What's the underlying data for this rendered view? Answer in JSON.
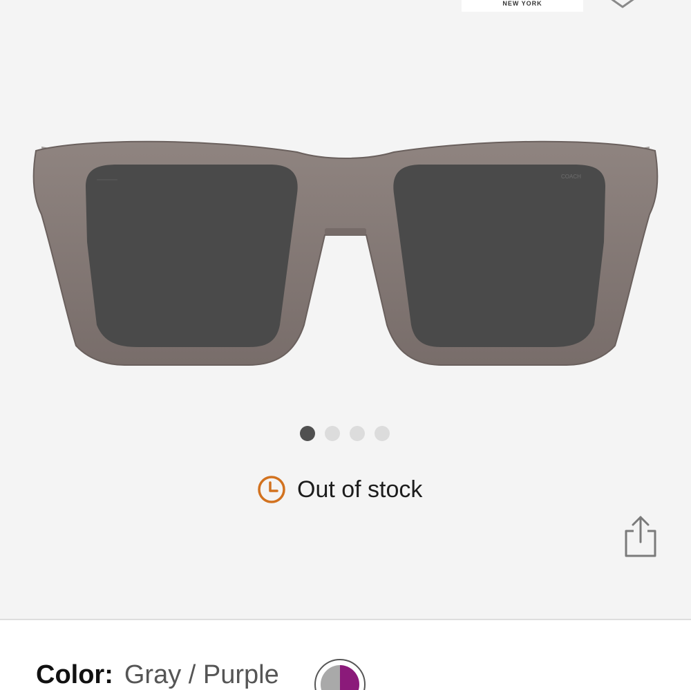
{
  "brand": {
    "logo_text": "NEW YORK"
  },
  "gallery": {
    "image_alt": "Gray / Purple square sunglasses, front view",
    "slide_count": 4,
    "active_slide": 1
  },
  "stock": {
    "status_text": "Out of stock",
    "icon": "clock-icon",
    "icon_color": "#d2721f"
  },
  "actions": {
    "share_icon": "share-icon",
    "favorite_icon": "heart-icon"
  },
  "color": {
    "label": "Color:",
    "value": "Gray / Purple",
    "swatch_colors": [
      "#a9a9a9",
      "#8b1a7a"
    ]
  }
}
